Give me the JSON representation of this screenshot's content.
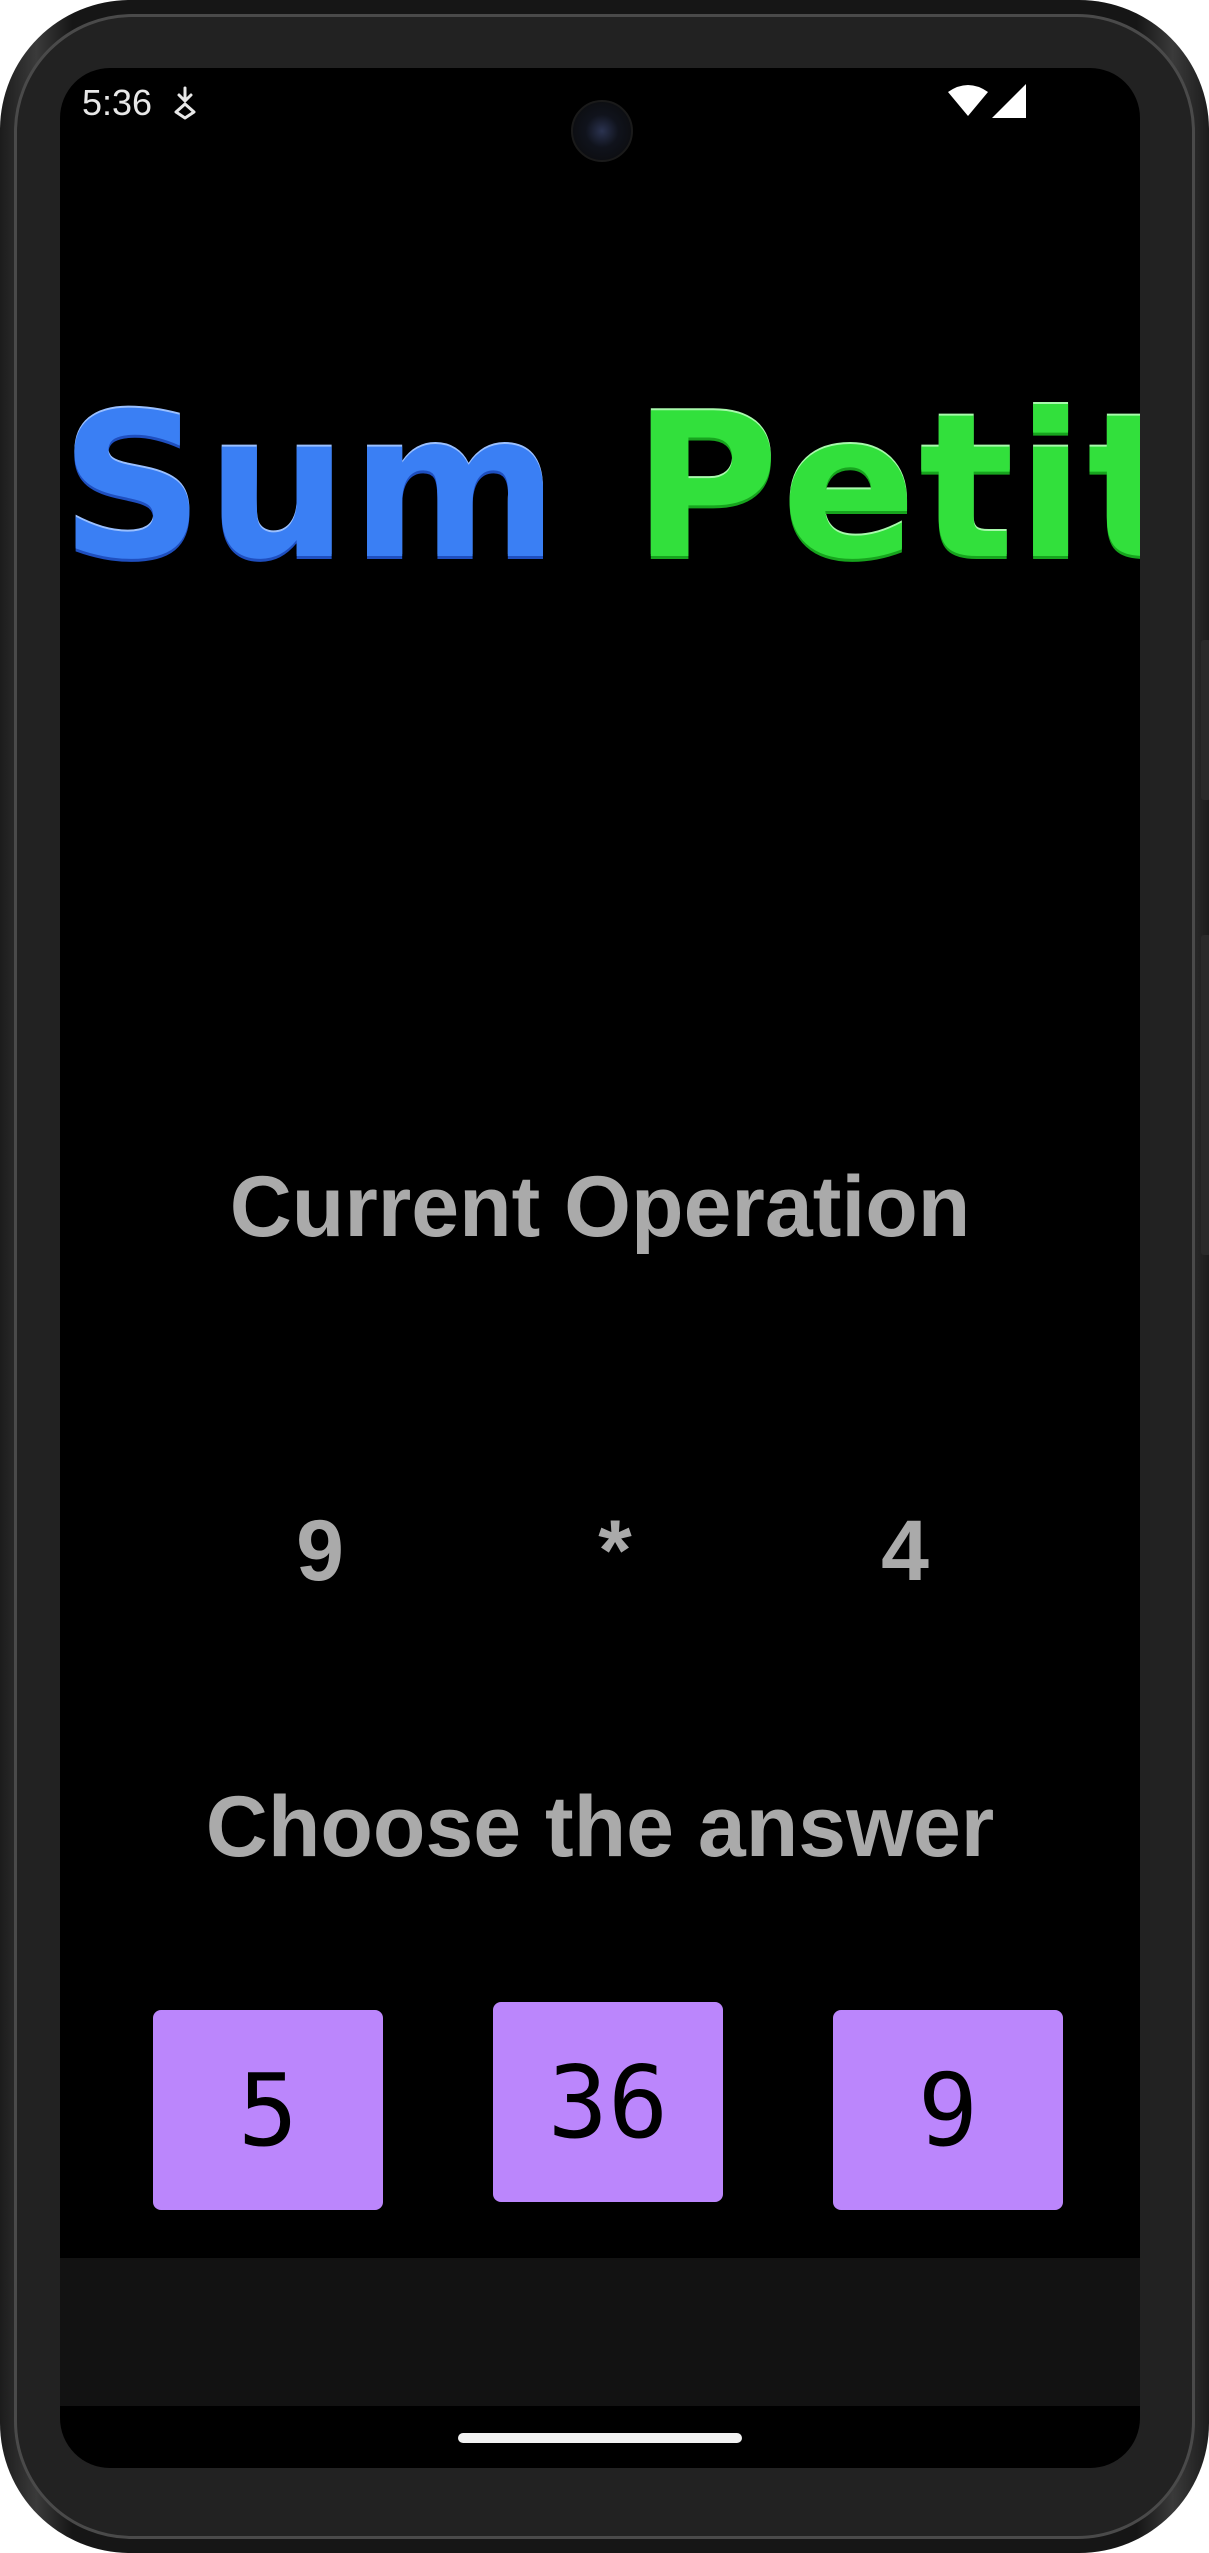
{
  "status_bar": {
    "time": "5:36",
    "notification_icon": "download-notification-icon",
    "wifi_icon": "wifi-icon",
    "signal_icon": "cell-signal-icon"
  },
  "app": {
    "logo_word_1": "Sum",
    "logo_word_2": "Petit",
    "logo_color_1": "#3a7ff4",
    "logo_color_2": "#32e03c",
    "current_operation_label": "Current Operation",
    "operation": {
      "operand_a": "9",
      "operator": "*",
      "operand_b": "4"
    },
    "choose_answer_label": "Choose the answer",
    "answers": [
      "5",
      "36",
      "9"
    ],
    "answer_button_color": "#bb86fc"
  }
}
